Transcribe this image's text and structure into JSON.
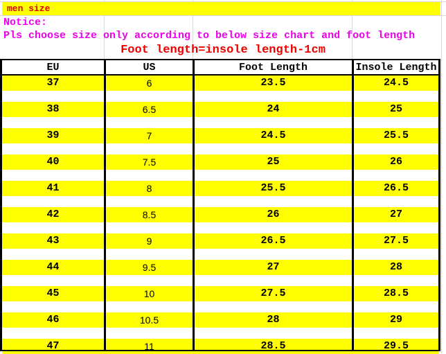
{
  "notice": {
    "banner_label": "men size",
    "line1": "Notice:",
    "line2": "Pls choose size only according to below size chart and foot length",
    "formula": "Foot length=insole length-1cm"
  },
  "colors": {
    "banner_background": "#ffff00",
    "banner_text": "#dd0000",
    "notice_text": "#ee00ee",
    "formula_text": "#ee0000",
    "row_highlight": "#ffff00",
    "border": "#000000"
  },
  "table": {
    "headers": [
      "EU",
      "US",
      "Foot Length",
      "Insole Length"
    ],
    "rows": [
      [
        "37",
        "6",
        "23.5",
        "24.5"
      ],
      [
        "38",
        "6.5",
        "24",
        "25"
      ],
      [
        "39",
        "7",
        "24.5",
        "25.5"
      ],
      [
        "40",
        "7.5",
        "25",
        "26"
      ],
      [
        "41",
        "8",
        "25.5",
        "26.5"
      ],
      [
        "42",
        "8.5",
        "26",
        "27"
      ],
      [
        "43",
        "9",
        "26.5",
        "27.5"
      ],
      [
        "44",
        "9.5",
        "27",
        "28"
      ],
      [
        "45",
        "10",
        "27.5",
        "28.5"
      ],
      [
        "46",
        "10.5",
        "28",
        "29"
      ],
      [
        "47",
        "11",
        "28.5",
        "29.5"
      ]
    ]
  }
}
